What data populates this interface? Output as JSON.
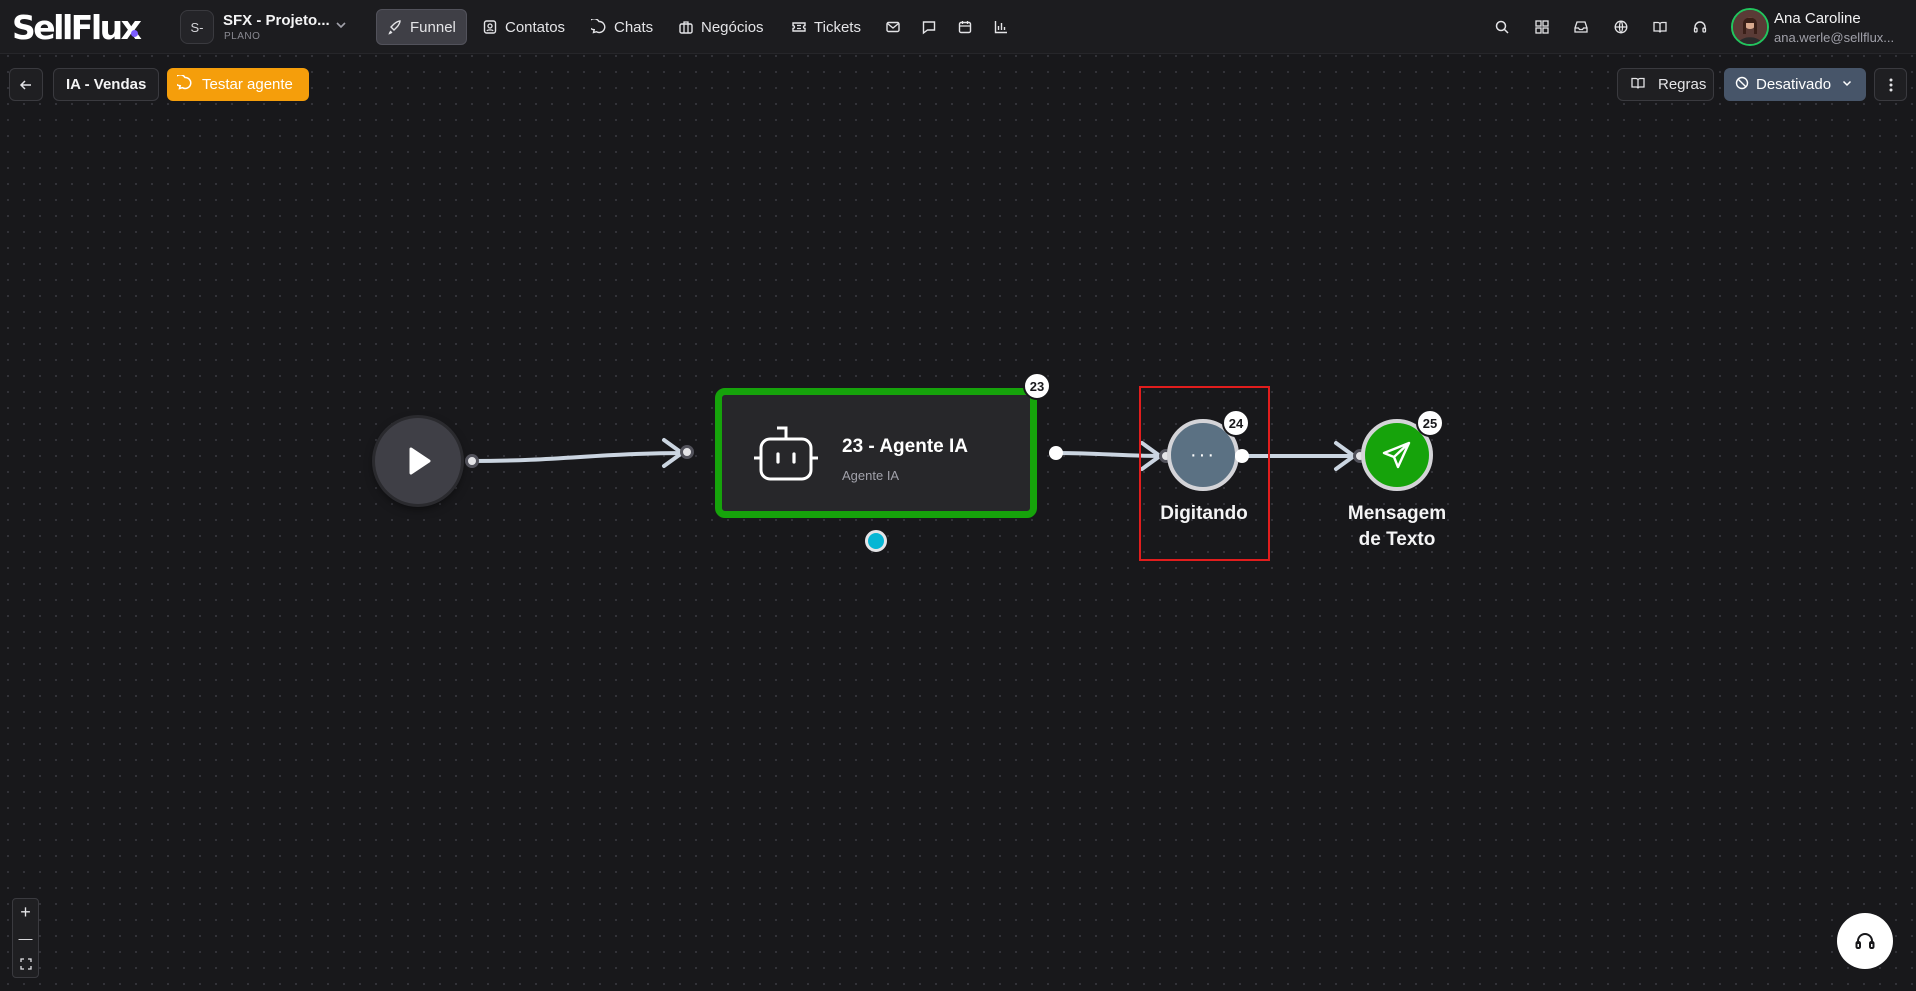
{
  "brand": {
    "logo_text": "SellFlux",
    "accent": "#7c5cff"
  },
  "project": {
    "initials": "S-",
    "name": "SFX - Projeto...",
    "plan": "PLANO"
  },
  "nav": {
    "funnel": "Funnel",
    "contacts": "Contatos",
    "chats": "Chats",
    "deals": "Negócios",
    "tickets": "Tickets"
  },
  "user": {
    "name": "Ana Caroline",
    "email": "ana.werle@sellflux..."
  },
  "toolbar": {
    "breadcrumb": "IA - Vendas",
    "test_agent": "Testar agente",
    "rules": "Regras",
    "status": "Desativado"
  },
  "flow": {
    "agent_node": {
      "badge": "23",
      "title": "23 - Agente IA",
      "subtitle": "Agente IA",
      "border_color": "#16a30b"
    },
    "typing_node": {
      "badge": "24",
      "label": "Digitando",
      "dots": "···"
    },
    "message_node": {
      "badge": "25",
      "label_line1": "Mensagem",
      "label_line2": "de Texto",
      "color": "#16a30b"
    }
  },
  "zoom": {
    "in": "+",
    "out": "—"
  }
}
